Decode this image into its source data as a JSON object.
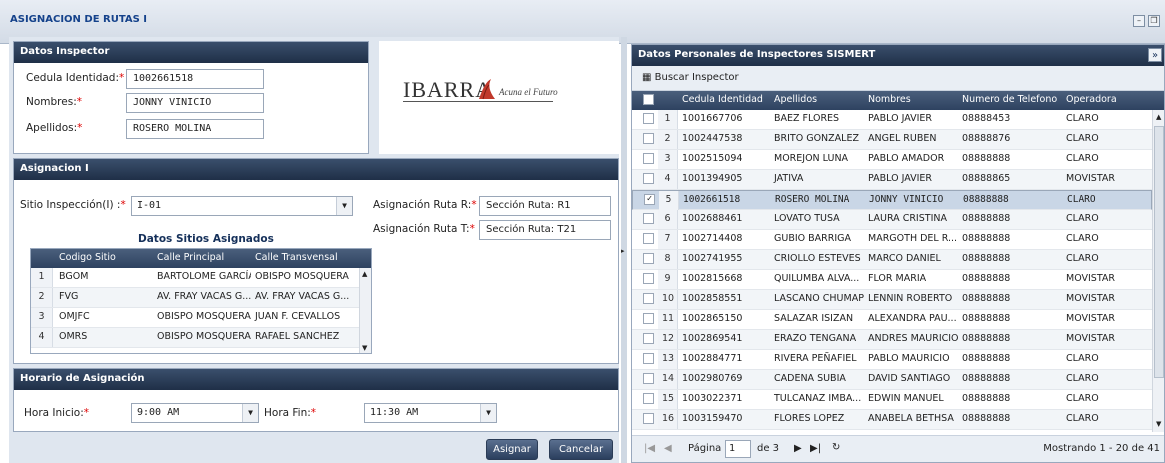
{
  "window": {
    "title": "ASIGNACION DE RUTAS I",
    "min_icon": "minimize-icon",
    "max_icon": "maximize-icon"
  },
  "inspector": {
    "header": "Datos Inspector",
    "cedula_label": "Cedula Identidad:",
    "cedula": "1002661518",
    "nombres_label": "Nombres:",
    "nombres": "JONNY VINICIO",
    "apellidos_label": "Apellidos:",
    "apellidos": "ROSERO MOLINA",
    "logo_text": "IBARRA",
    "logo_tagline": "Acuna el Futuro"
  },
  "asignacion": {
    "header": "Asignacion I",
    "sitio_label": "Sitio Inspección(I) :",
    "sitio_value": "I-01",
    "ruta_r_label": "Asignación Ruta R:",
    "ruta_r_value": "Sección Ruta: R1",
    "ruta_t_label": "Asignación Ruta T:",
    "ruta_t_value": "Sección Ruta: T21",
    "sitios_title": "Datos Sitios Asignados",
    "sitios_cols": [
      "Codigo Sitio",
      "Calle Principal",
      "Calle Transvensal"
    ],
    "sitios": [
      [
        "1",
        "BGOM",
        "BARTOLOME GARCÍA",
        "OBISPO MOSQUERA"
      ],
      [
        "2",
        "FVG",
        "AV. FRAY VACAS G...",
        "AV. FRAY VACAS G..."
      ],
      [
        "3",
        "OMJFC",
        "OBISPO MOSQUERA",
        "JUAN F. CEVALLOS"
      ],
      [
        "4",
        "OMRS",
        "OBISPO MOSQUERA",
        "RAFAEL SANCHEZ"
      ]
    ]
  },
  "horario": {
    "header": "Horario de Asignación",
    "inicio_label": "Hora Inicio:",
    "inicio": "9:00 AM",
    "fin_label": "Hora Fin:",
    "fin": "11:30 AM"
  },
  "buttons": {
    "asignar": "Asignar",
    "cancelar": "Cancelar"
  },
  "right": {
    "header": "Datos Personales de Inspectores SISMERT",
    "buscar": "Buscar Inspector",
    "cols": [
      "Cedula Identidad",
      "Apellidos",
      "Nombres",
      "Numero de Telefono",
      "Operadora"
    ],
    "rows": [
      [
        "1",
        "1001667706",
        "BAEZ FLORES",
        "PABLO JAVIER",
        "08888453",
        "CLARO"
      ],
      [
        "2",
        "1002447538",
        "BRITO GONZALEZ",
        "ANGEL RUBEN",
        "08888876",
        "CLARO"
      ],
      [
        "3",
        "1002515094",
        "MOREJON LUNA",
        "PABLO AMADOR",
        "08888888",
        "CLARO"
      ],
      [
        "4",
        "1001394905",
        "JATIVA",
        "PABLO JAVIER",
        "08888865",
        "MOVISTAR"
      ],
      [
        "5",
        "1002661518",
        "ROSERO MOLINA",
        "JONNY VINICIO",
        "08888888",
        "CLARO"
      ],
      [
        "6",
        "1002688461",
        "LOVATO TUSA",
        "LAURA CRISTINA",
        "08888888",
        "CLARO"
      ],
      [
        "7",
        "1002714408",
        "GUBIO BARRIGA",
        "MARGOTH DEL R...",
        "08888888",
        "CLARO"
      ],
      [
        "8",
        "1002741955",
        "CRIOLLO ESTEVES",
        "MARCO DANIEL",
        "08888888",
        "CLARO"
      ],
      [
        "9",
        "1002815668",
        "QUILUMBA ALVA...",
        "FLOR MARIA",
        "08888888",
        "MOVISTAR"
      ],
      [
        "10",
        "1002858551",
        "LASCANO CHUMAPI",
        "LENNIN ROBERTO",
        "08888888",
        "MOVISTAR"
      ],
      [
        "11",
        "1002865150",
        "SALAZAR ISIZAN",
        "ALEXANDRA PAU...",
        "08888888",
        "MOVISTAR"
      ],
      [
        "12",
        "1002869541",
        "ERAZO TENGANA",
        "ANDRES MAURICIO",
        "08888888",
        "MOVISTAR"
      ],
      [
        "13",
        "1002884771",
        "RIVERA PEÑAFIEL",
        "PABLO MAURICIO",
        "08888888",
        "CLARO"
      ],
      [
        "14",
        "1002980769",
        "CADENA SUBIA",
        "DAVID SANTIAGO",
        "08888888",
        "CLARO"
      ],
      [
        "15",
        "1003022371",
        "TULCANAZ IMBA...",
        "EDWIN MANUEL",
        "08888888",
        "CLARO"
      ],
      [
        "16",
        "1003159470",
        "FLORES LOPEZ",
        "ANABELA BETHSA",
        "08888888",
        "CLARO"
      ]
    ],
    "selected_index": 4,
    "pager": {
      "page_label": "Página",
      "page": "1",
      "of": "de 3",
      "showing": "Mostrando 1 - 20 de 41"
    }
  }
}
